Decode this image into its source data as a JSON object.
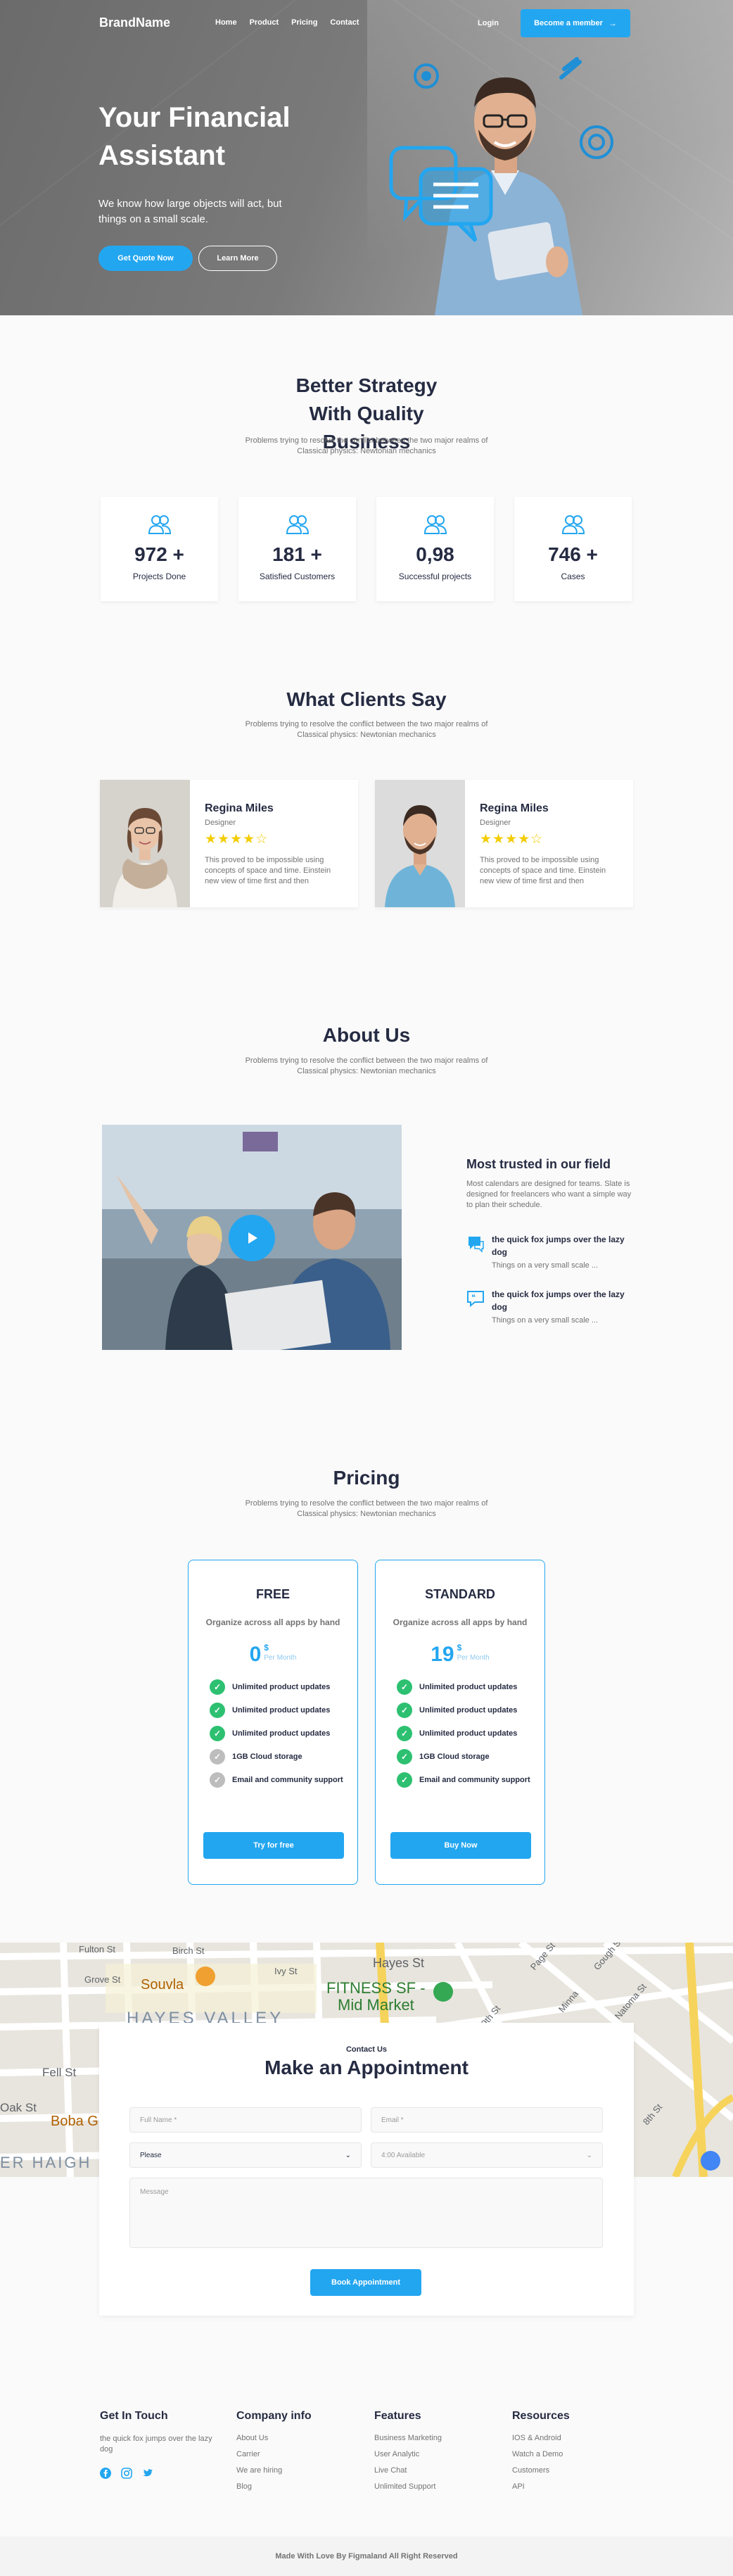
{
  "colors": {
    "primary": "#23a6f0",
    "dark": "#252b42",
    "muted": "#737373",
    "star": "#f3cd03",
    "success": "#2dc071",
    "disabled": "#bdbdbd"
  },
  "nav": {
    "brand": "BrandName",
    "links": [
      "Home",
      "Product",
      "Pricing",
      "Contact"
    ],
    "login": "Login",
    "cta": "Become a member",
    "cta_icon": "arrow-right-icon"
  },
  "hero": {
    "title": "Your Financial Assistant",
    "description": "We know how large objects will act, but things on a small scale.",
    "primary_button": "Get Quote Now",
    "secondary_button": "Learn More"
  },
  "strategy": {
    "title": "Better Strategy With Quality Business",
    "subtitle": "Problems trying to resolve the conflict between the two major realms of Classical physics: Newtonian mechanics",
    "stats": [
      {
        "icon": "users-icon",
        "value": "972 +",
        "label": "Projects Done"
      },
      {
        "icon": "users-icon",
        "value": "181 +",
        "label": "Satisfied Customers"
      },
      {
        "icon": "users-icon",
        "value": "0,98",
        "label": "Successful projects"
      },
      {
        "icon": "users-icon",
        "value": "746 +",
        "label": "Cases"
      }
    ]
  },
  "clients": {
    "title": "What Clients Say",
    "subtitle": "Problems trying to resolve the conflict between the two major realms of Classical physics: Newtonian mechanics",
    "testimonials": [
      {
        "name": "Regina Miles",
        "role": "Designer",
        "rating": 4,
        "stars": "★★★★☆",
        "quote": "This proved to be impossible using concepts of space and time. Einstein new view of time first and then"
      },
      {
        "name": "Regina Miles",
        "role": "Designer",
        "rating": 4,
        "stars": "★★★★☆",
        "quote": "This proved to be impossible using concepts of space and time. Einstein new view of time first and then"
      }
    ]
  },
  "about": {
    "title": "About Us",
    "subtitle": "Problems trying to resolve the conflict between the two major realms of Classical physics: Newtonian mechanics",
    "trust_title": "Most trusted in our field",
    "trust_desc": "Most calendars are designed for teams. Slate is designed for freelancers who want a simple way to plan their schedule.",
    "features": [
      {
        "icon": "chat-bubble-icon",
        "title": "the quick fox jumps over the lazy dog",
        "text": "Things on a very small scale ..."
      },
      {
        "icon": "quote-bubble-icon",
        "title": "the quick fox jumps over the lazy dog",
        "text": "Things on a very small scale ..."
      }
    ]
  },
  "pricing": {
    "title": "Pricing",
    "subtitle": "Problems trying to resolve the conflict between the two major realms of Classical physics: Newtonian mechanics",
    "plans": [
      {
        "name": "FREE",
        "desc": "Organize across all apps by hand",
        "price": "0",
        "currency": "$",
        "period": "Per Month",
        "features": [
          {
            "text": "Unlimited product updates",
            "included": true
          },
          {
            "text": "Unlimited product updates",
            "included": true
          },
          {
            "text": "Unlimited product updates",
            "included": true
          },
          {
            "text": "1GB  Cloud storage",
            "included": false
          },
          {
            "text": "Email and community support",
            "included": false
          }
        ],
        "button": "Try for free"
      },
      {
        "name": "STANDARD",
        "desc": "Organize across all apps by hand",
        "price": "19",
        "currency": "$",
        "period": "Per Month",
        "features": [
          {
            "text": "Unlimited product updates",
            "included": true
          },
          {
            "text": "Unlimited product updates",
            "included": true
          },
          {
            "text": "Unlimited product updates",
            "included": true
          },
          {
            "text": "1GB  Cloud storage",
            "included": true
          },
          {
            "text": "Email and community support",
            "included": true
          }
        ],
        "button": "Buy Now"
      }
    ]
  },
  "map": {
    "labels": [
      "Fulton St",
      "Birch St",
      "Grove St",
      "Ivy St",
      "Hayes St",
      "Souvla",
      "FITNESS SF -",
      "Mid Market",
      "HAYES VALLEY",
      "Fell St",
      "Oak St",
      "Boba G",
      "ER HAIGH",
      "9th St",
      "Minna",
      "Natoma St",
      "8th St",
      "Gough St",
      "Page St"
    ]
  },
  "appointment": {
    "kicker": "Contact Us",
    "title": "Make an Appointment",
    "full_name_placeholder": "Full Name *",
    "email_placeholder": "Email *",
    "select_value": "Please",
    "select_placeholder": "4:00 Available",
    "message_placeholder": "Message",
    "button": "Book Appointment"
  },
  "footer": {
    "get_in_touch": {
      "title": "Get In Touch",
      "text": "the quick fox jumps over the lazy dog",
      "socials": [
        "facebook-icon",
        "instagram-icon",
        "twitter-icon"
      ]
    },
    "company": {
      "title": "Company info",
      "links": [
        "About Us",
        "Carrier",
        "We are hiring",
        "Blog"
      ]
    },
    "features": {
      "title": "Features",
      "links": [
        "Business Marketing",
        "User Analytic",
        "Live Chat",
        "Unlimited Support"
      ]
    },
    "resources": {
      "title": "Resources",
      "links": [
        "IOS & Android",
        "Watch a Demo",
        "Customers",
        "API"
      ]
    },
    "copyright": "Made With Love By Figmaland All Right Reserved"
  }
}
